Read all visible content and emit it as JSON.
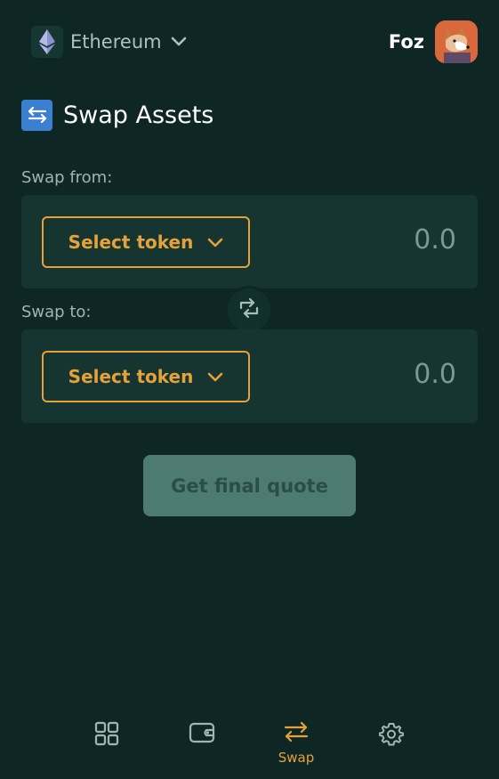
{
  "header": {
    "network": {
      "label": "Ethereum",
      "icon": "ethereum-icon"
    },
    "account": {
      "name": "Foz",
      "avatar": "dog-avatar"
    }
  },
  "page": {
    "title": "Swap Assets",
    "icon": "swap-arrows-icon"
  },
  "swap_from": {
    "label": "Swap from:",
    "token_button": "Select token",
    "amount": "0.0"
  },
  "swap_to": {
    "label": "Swap to:",
    "token_button": "Select token",
    "amount": "0.0"
  },
  "flip_button": {
    "icon": "flip-swap-icon"
  },
  "quote_button": {
    "label": "Get final quote",
    "disabled": true
  },
  "bottom_nav": {
    "items": [
      {
        "name": "dashboard",
        "icon": "grid-icon",
        "label": ""
      },
      {
        "name": "wallet",
        "icon": "wallet-icon",
        "label": ""
      },
      {
        "name": "swap",
        "icon": "swap-icon",
        "label": "Swap",
        "active": true
      },
      {
        "name": "settings",
        "icon": "gear-icon",
        "label": ""
      }
    ]
  },
  "colors": {
    "background": "#0f2724",
    "panel": "#163530",
    "accent": "#e6a23a",
    "disabled_button": "#4d7a71"
  }
}
